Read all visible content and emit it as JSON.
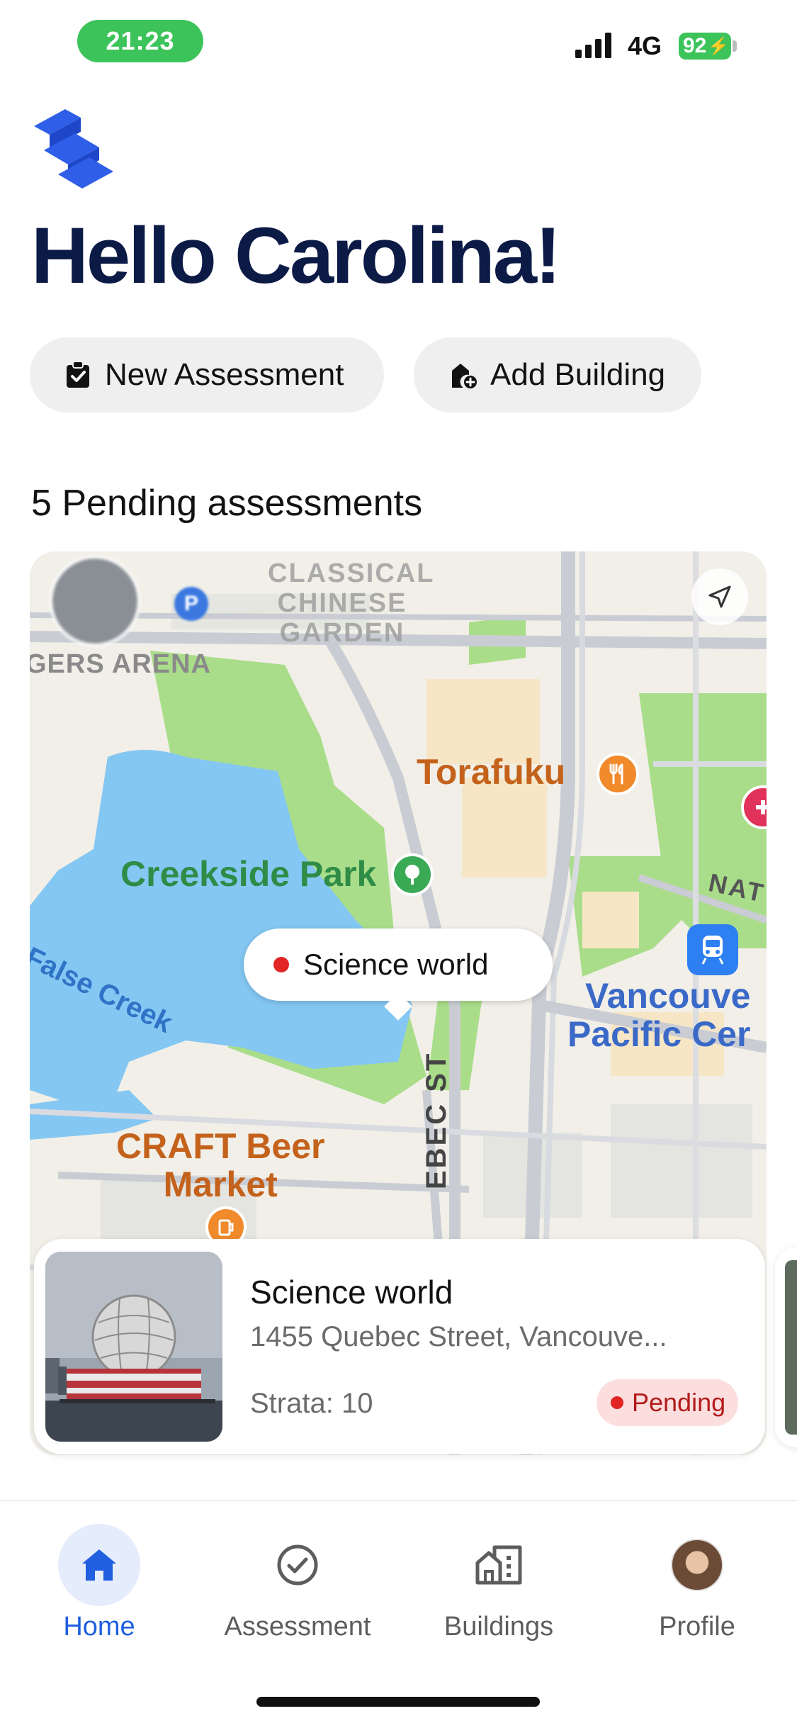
{
  "status_bar": {
    "time": "21:23",
    "network": "4G",
    "battery": "92"
  },
  "header": {
    "greeting": "Hello Carolina!"
  },
  "actions": {
    "new_assessment": "New Assessment",
    "add_building": "Add Building"
  },
  "pending": {
    "title": "5 Pending assessments"
  },
  "map": {
    "labels": {
      "chinese_garden": "CLASSICAL CHINESE GARDEN",
      "arena": "GERS ARENA",
      "torafuku": "Torafuku",
      "creekside": "Creekside Park",
      "false_creek": "False Creek",
      "vancouver": "Vancouve",
      "vancouver_2": "Pacific Cer",
      "craft": "CRAFT Beer",
      "craft_2": "Market",
      "quebec": "EBEC ST",
      "nat": "NAT"
    },
    "callout": "Science world",
    "colors": {
      "water": "#84c7f3",
      "park": "#a9dd8a",
      "road": "#c9cdd3"
    }
  },
  "card": {
    "title": "Science world",
    "address": "1455 Quebec Street, Vancouve...",
    "strata": "Strata: 10",
    "status": "Pending"
  },
  "tabs": [
    {
      "label": "Home",
      "icon": "home-icon",
      "active": true
    },
    {
      "label": "Assessment",
      "icon": "check-circle-icon",
      "active": false
    },
    {
      "label": "Buildings",
      "icon": "buildings-icon",
      "active": false
    },
    {
      "label": "Profile",
      "icon": "profile-avatar",
      "active": false
    }
  ],
  "colors": {
    "accent": "#1f5fe0",
    "navy": "#0c1a46",
    "pending_bg": "#fcdede",
    "pending_text": "#b31b1b"
  }
}
